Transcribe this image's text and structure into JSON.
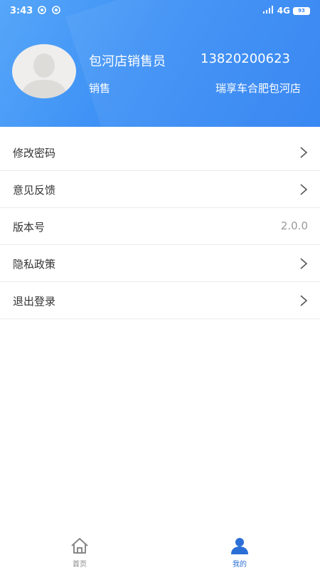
{
  "status_bar": {
    "time": "3:43",
    "network": "4G",
    "battery": "93"
  },
  "profile": {
    "name": "包河店销售员",
    "phone": "13820200623",
    "role": "销售",
    "store": "瑞享车合肥包河店"
  },
  "menu": {
    "items": [
      {
        "label": "修改密码"
      },
      {
        "label": "意见反馈"
      },
      {
        "label": "版本号",
        "value": "2.0.0"
      },
      {
        "label": "隐私政策"
      },
      {
        "label": "退出登录"
      }
    ]
  },
  "tabbar": {
    "tabs": [
      {
        "label": "首页",
        "icon": "home-icon",
        "active": false
      },
      {
        "label": "我的",
        "icon": "user-icon",
        "active": true
      }
    ]
  },
  "colors": {
    "header_start": "#56a6f9",
    "header_end": "#2d80f2",
    "active_tab": "#2b6fd6",
    "inactive_tab": "#888888"
  }
}
